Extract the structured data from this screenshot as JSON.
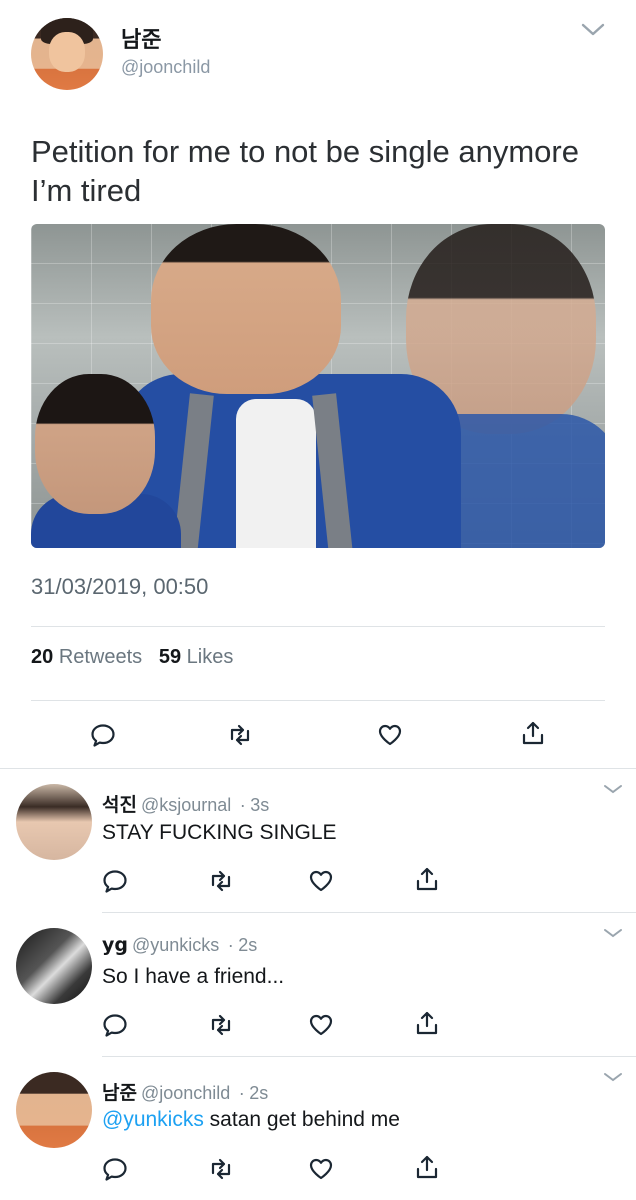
{
  "main_tweet": {
    "display_name": "남준",
    "handle": "@joonchild",
    "text_line1": "Petition for me to not be single anymore",
    "text_line2": "I’m tired",
    "timestamp": "31/03/2019, 00:50",
    "retweets_count": "20",
    "retweets_label": "Retweets",
    "likes_count": "59",
    "likes_label": "Likes"
  },
  "replies": [
    {
      "display_name": "석진",
      "handle": "@ksjournal",
      "time": "3s",
      "text": "STAY FUCKING SINGLE",
      "mention": ""
    },
    {
      "display_name": "yg",
      "handle": "@yunkicks",
      "time": "2s",
      "text": "So I have a friend...",
      "mention": ""
    },
    {
      "display_name": "남준",
      "handle": "@joonchild",
      "time": "2s",
      "text": " satan get behind me",
      "mention": "@yunkicks"
    }
  ],
  "separator": "·",
  "icons": [
    "chevron-down-icon",
    "reply-icon",
    "retweet-icon",
    "like-icon",
    "share-icon"
  ],
  "colors": {
    "link": "#1da1f2",
    "secondary_text": "#8b98a5",
    "icon": "#1b2733",
    "divider": "#dfe3e6"
  }
}
